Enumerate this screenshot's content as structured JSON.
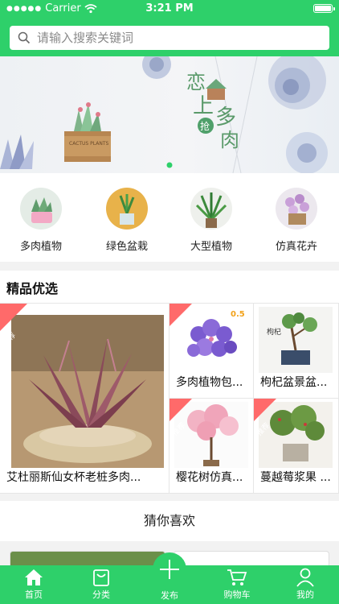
{
  "status_bar": {
    "carrier": "Carrier",
    "time": "3:21 PM"
  },
  "search": {
    "placeholder": "请输入搜索关键词"
  },
  "banner": {
    "text_main_1": "恋",
    "text_main_2": "上",
    "text_main_3": "多",
    "text_main_4": "肉",
    "text_badge": "抢",
    "crate_label": "CACTUS PLANTS"
  },
  "categories": [
    {
      "label": "多肉植物"
    },
    {
      "label": "绿色盆栽"
    },
    {
      "label": "大型植物"
    },
    {
      "label": "仿真花卉"
    }
  ],
  "featured": {
    "title": "精品优选",
    "tag": "推荐",
    "items": [
      {
        "name": "艾杜丽斯仙女杯老桩多肉..."
      },
      {
        "name": "多肉植物包...",
        "badge": "0.5"
      },
      {
        "name": "枸杞盆景盆...",
        "pot_label": "枸杞"
      },
      {
        "name": "樱花树仿真..."
      },
      {
        "name": "蔓越莓浆果 ..."
      }
    ]
  },
  "guess": {
    "title": "猜你喜欢"
  },
  "tabbar": [
    {
      "label": "首页"
    },
    {
      "label": "分类"
    },
    {
      "label": "发布"
    },
    {
      "label": "购物车"
    },
    {
      "label": "我的"
    }
  ],
  "colors": {
    "brand": "#2ed06a"
  }
}
